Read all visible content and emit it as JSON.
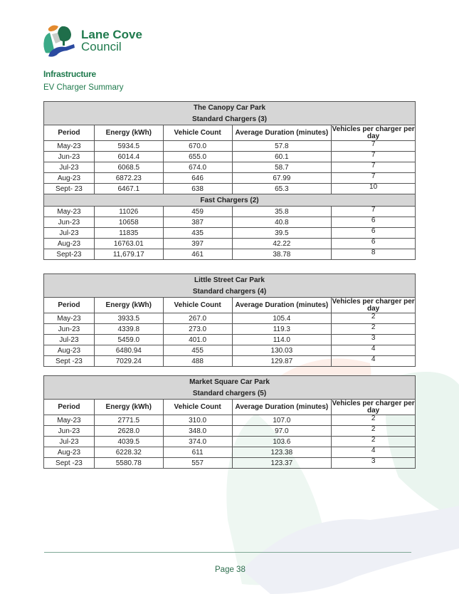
{
  "header": {
    "logo_line1": "Lane Cove",
    "logo_line2": "Council",
    "section_title": "Infrastructure",
    "section_subtitle": "EV Charger Summary"
  },
  "columns": [
    "Period",
    "Energy (kWh)",
    "Vehicle Count",
    "Average Duration (minutes)",
    "Vehicles per charger per day"
  ],
  "tables": [
    {
      "title": "The Canopy Car Park",
      "groups": [
        {
          "label": "Standard Chargers (3)",
          "rows": [
            [
              "May-23",
              "5934.5",
              "670.0",
              "57.8",
              "7"
            ],
            [
              "Jun-23",
              "6014.4",
              "655.0",
              "60.1",
              "7"
            ],
            [
              "Jul-23",
              "6068.5",
              "674.0",
              "58.7",
              "7"
            ],
            [
              "Aug-23",
              "6872.23",
              "646",
              "67.99",
              "7"
            ],
            [
              "Sept- 23",
              "6467.1",
              "638",
              "65.3",
              "10"
            ]
          ]
        },
        {
          "label": "Fast Chargers (2)",
          "rows": [
            [
              "May-23",
              "11026",
              "459",
              "35.8",
              "7"
            ],
            [
              "Jun-23",
              "10658",
              "387",
              "40.8",
              "6"
            ],
            [
              "Jul-23",
              "11835",
              "435",
              "39.5",
              "6"
            ],
            [
              "Aug-23",
              "16763.01",
              "397",
              "42.22",
              "6"
            ],
            [
              "Sept-23",
              "11,679.17",
              "461",
              "38.78",
              "8"
            ]
          ]
        }
      ]
    },
    {
      "title": "Little Street Car Park",
      "groups": [
        {
          "label": "Standard chargers (4)",
          "rows": [
            [
              "May-23",
              "3933.5",
              "267.0",
              "105.4",
              "2"
            ],
            [
              "Jun-23",
              "4339.8",
              "273.0",
              "119.3",
              "2"
            ],
            [
              "Jul-23",
              "5459.0",
              "401.0",
              "114.0",
              "3"
            ],
            [
              "Aug-23",
              "6480.94",
              "455",
              "130.03",
              "4"
            ],
            [
              "Sept -23",
              "7029.24",
              "488",
              "129.87",
              "4"
            ]
          ]
        }
      ]
    },
    {
      "title": "Market Square Car Park",
      "groups": [
        {
          "label": "Standard chargers (5)",
          "rows": [
            [
              "May-23",
              "2771.5",
              "310.0",
              "107.0",
              "2"
            ],
            [
              "Jun-23",
              "2628.0",
              "348.0",
              "97.0",
              "2"
            ],
            [
              "Jul-23",
              "4039.5",
              "374.0",
              "103.6",
              "2"
            ],
            [
              "Aug-23",
              "6228.32",
              "611",
              "123.38",
              "4"
            ],
            [
              "Sept -23",
              "5580.78",
              "557",
              "123.37",
              "3"
            ]
          ]
        }
      ]
    }
  ],
  "footer": {
    "page_label": "Page 38"
  },
  "colors": {
    "brand_green": "#1f7a4d",
    "band_gray": "#d6d6d6"
  }
}
